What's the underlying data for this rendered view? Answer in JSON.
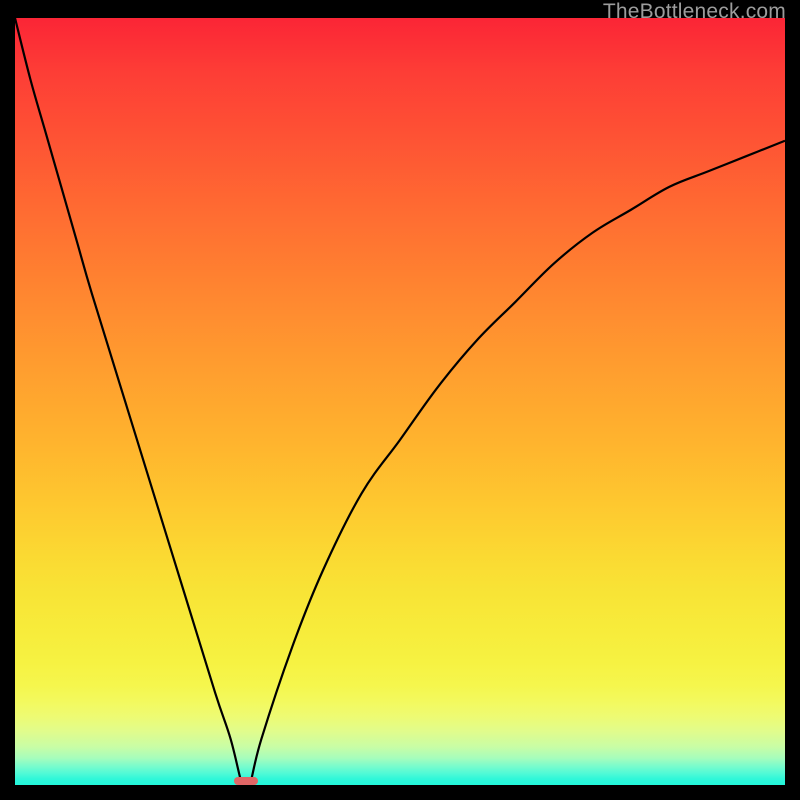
{
  "watermark": "TheBottleneck.com",
  "colors": {
    "curve_stroke": "#000000",
    "marker_fill": "#e06666",
    "gradient_top": "#fb2536",
    "gradient_bottom": "#22f6da"
  },
  "chart_data": {
    "type": "line",
    "title": "",
    "xlabel": "",
    "ylabel": "",
    "xlim": [
      0,
      100
    ],
    "ylim": [
      0,
      100
    ],
    "annotations": [],
    "series": [
      {
        "name": "bottleneck-curve",
        "comment": "V-shaped curve; x is horizontal position (% of plot width L→R), y is bottleneck % (0 at bottom, 100 at top). Minimum at x≈30.",
        "x": [
          0,
          2,
          4,
          6,
          8,
          10,
          14,
          18,
          22,
          26,
          28,
          29.5,
          30,
          30.5,
          32,
          36,
          40,
          45,
          50,
          55,
          60,
          65,
          70,
          75,
          80,
          85,
          90,
          95,
          100
        ],
        "y": [
          100,
          92,
          85,
          78,
          71,
          64,
          51,
          38,
          25,
          12,
          6,
          0,
          0,
          0,
          6,
          18,
          28,
          38,
          45,
          52,
          58,
          63,
          68,
          72,
          75,
          78,
          80,
          82,
          84
        ]
      }
    ],
    "marker": {
      "comment": "Small salmon pill at the curve minimum along the x axis",
      "x_center_pct": 30,
      "width_pct": 3.2,
      "y_pct": 0
    }
  }
}
